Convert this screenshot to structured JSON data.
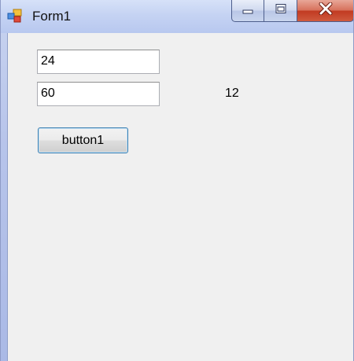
{
  "window": {
    "title": "Form1"
  },
  "icons": {
    "app": "form-app-icon",
    "minimize": "minimize-icon",
    "maximize": "maximize-icon",
    "close": "close-icon"
  },
  "colors": {
    "client_background": "#f0f0f0",
    "close_button": "#c13a22",
    "button_border": "#3c7fb1"
  },
  "form": {
    "textbox1_value": "24",
    "textbox2_value": "60",
    "result_label": "12",
    "button_label": "button1"
  }
}
